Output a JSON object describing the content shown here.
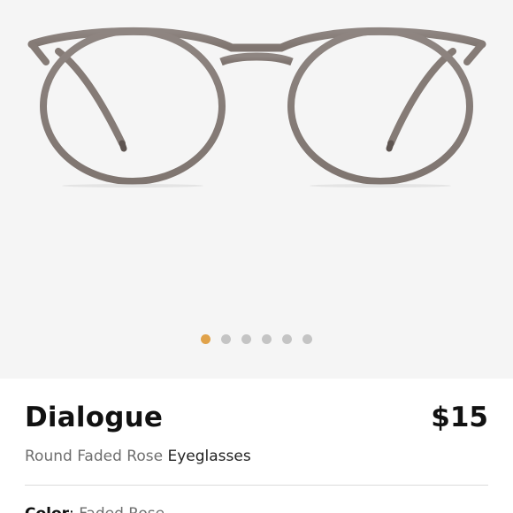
{
  "product": {
    "name": "Dialogue",
    "price": "$15",
    "shape_color": "Round Faded Rose",
    "type": "Eyeglasses"
  },
  "color_row": {
    "label": "Color",
    "value": "Faded Rose"
  },
  "gallery": {
    "dot_count": 6,
    "active_index": 0
  },
  "colors": {
    "frame": "#8b7f7a",
    "gallery_bg": "#f5f5f5",
    "dot_active": "#e0a24a",
    "dot_inactive": "#c4c4c4"
  },
  "icons": {
    "product_image": "round-eyeglasses-frame"
  }
}
